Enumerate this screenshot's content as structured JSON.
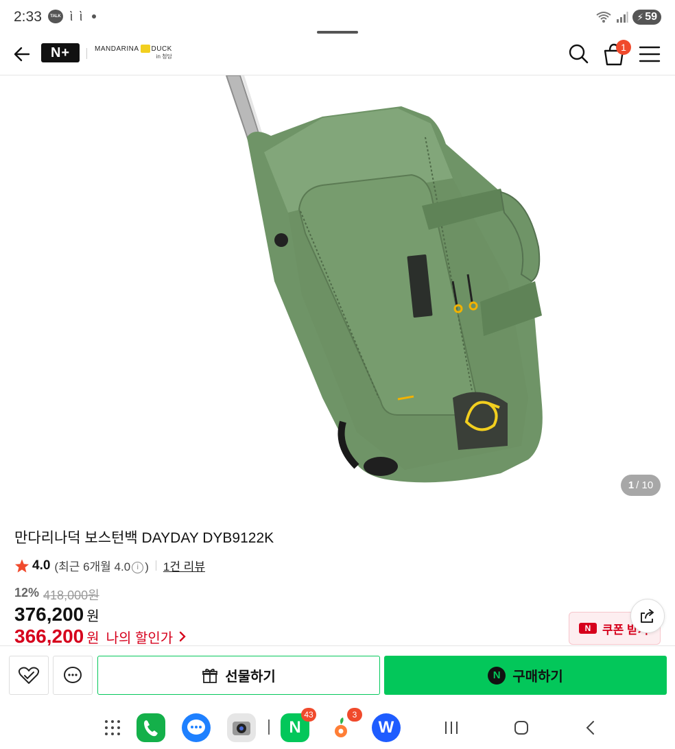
{
  "status_bar": {
    "time": "2:33",
    "talk_icon_label": "TALK",
    "battery": "59"
  },
  "header": {
    "brand_badge": "N+",
    "brand_name": "MANDARINA",
    "brand_name_suffix": "DUCK",
    "brand_sub": "in 청담",
    "cart_count": "1"
  },
  "gallery": {
    "current": "1",
    "total": "/ 10"
  },
  "product": {
    "title": "만다리나덕 보스턴백 DAYDAY DYB9122K",
    "rating": "4.0",
    "rating_detail_prefix": "(최근 6개월 4.0",
    "rating_detail_suffix": ")",
    "info_glyph": "i",
    "review_link": "1건 리뷰",
    "discount_rate": "12%",
    "original_price": "418,000원",
    "price": "376,200",
    "price_unit": "원",
    "my_price": "366,200",
    "my_price_unit": "원",
    "my_price_label": "나의 할인가"
  },
  "coupon": {
    "badge": "N",
    "label": "쿠폰 받기"
  },
  "actions": {
    "gift_label": "선물하기",
    "buy_label": "구매하기",
    "npay_badge": "N"
  },
  "dock": {
    "naver_badge": "43",
    "carrot_badge": "3",
    "naver_letter": "N",
    "w_letter": "W"
  },
  "colors": {
    "naver_green": "#03c75a",
    "sale_red": "#d6001c",
    "bag_green": "#6f9467"
  }
}
